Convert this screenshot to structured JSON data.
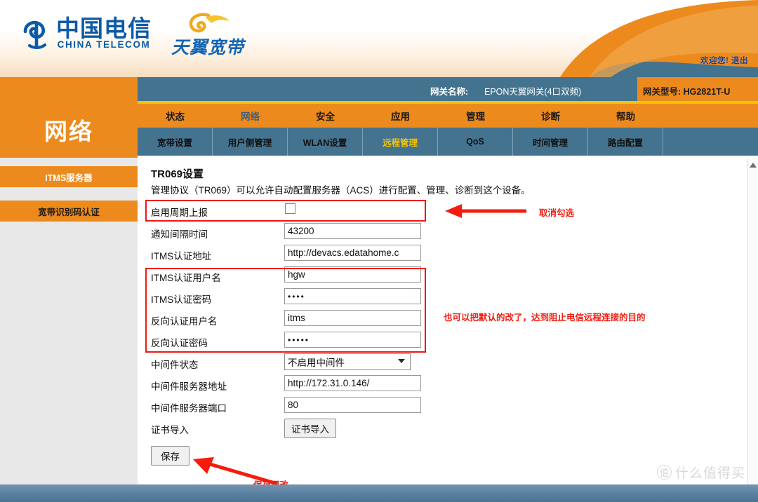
{
  "brand": {
    "telecom_hanzi": "中国电信",
    "telecom_en": "CHINA TELECOM",
    "tianyi_hanzi": "天翼宽带"
  },
  "header": {
    "welcome": "欢迎您!",
    "logout": "退出",
    "gateway_name_label": "网关名称:",
    "gateway_name_value": "EPON天翼网关(4口双频)",
    "gateway_model_label": "网关型号:",
    "gateway_model_value": "HG2821T-U"
  },
  "side_title": "网络",
  "nav": {
    "main": [
      {
        "label": "状态",
        "active": false
      },
      {
        "label": "网络",
        "active": true
      },
      {
        "label": "安全",
        "active": false
      },
      {
        "label": "应用",
        "active": false
      },
      {
        "label": "管理",
        "active": false
      },
      {
        "label": "诊断",
        "active": false
      },
      {
        "label": "帮助",
        "active": false
      }
    ],
    "sub": [
      {
        "label": "宽带设置",
        "active": false
      },
      {
        "label": "用户侧管理",
        "active": false
      },
      {
        "label": "WLAN设置",
        "active": false
      },
      {
        "label": "远程管理",
        "active": true
      },
      {
        "label": "QoS",
        "active": false
      },
      {
        "label": "时间管理",
        "active": false
      },
      {
        "label": "路由配置",
        "active": false
      },
      {
        "label": "",
        "active": false
      }
    ]
  },
  "sidebar": {
    "items": [
      {
        "label": "ITMS服务器",
        "selected": true
      },
      {
        "label": "宽带识别码认证",
        "selected": false
      }
    ]
  },
  "main": {
    "title": "TR069设置",
    "description": "管理协议（TR069）可以允许自动配置服务器（ACS）进行配置、管理、诊断到这个设备。",
    "fields": [
      {
        "label": "启用周期上报",
        "type": "checkbox",
        "value": "",
        "checked": false
      },
      {
        "label": "通知间隔时间",
        "type": "text",
        "value": "43200"
      },
      {
        "label": "ITMS认证地址",
        "type": "text",
        "value": "http://devacs.edatahome.c"
      },
      {
        "label": "ITMS认证用户名",
        "type": "text",
        "value": "hgw"
      },
      {
        "label": "ITMS认证密码",
        "type": "password",
        "value": "••••"
      },
      {
        "label": "反向认证用户名",
        "type": "text",
        "value": "itms"
      },
      {
        "label": "反向认证密码",
        "type": "password",
        "value": "•••••"
      },
      {
        "label": "中间件状态",
        "type": "select",
        "value": "不启用中间件"
      },
      {
        "label": "中间件服务器地址",
        "type": "text",
        "value": "http://172.31.0.146/"
      },
      {
        "label": "中间件服务器端口",
        "type": "text",
        "value": "80"
      },
      {
        "label": "证书导入",
        "type": "button",
        "value": "证书导入"
      }
    ],
    "save_button": "保存"
  },
  "annotations": {
    "uncheck": "取消勾选",
    "change_defaults": "也可以把默认的改了，达到阻止电信远程连接的目的",
    "save_changes": "保存更改"
  },
  "watermark": {
    "mark": "值",
    "text": "什么值得买"
  },
  "colors": {
    "orange": "#ec8a1e",
    "steel_blue": "#44738f",
    "yellow_accent": "#f5c400",
    "annotation_red": "#f41c0e",
    "brand_blue": "#0b5aa6"
  }
}
